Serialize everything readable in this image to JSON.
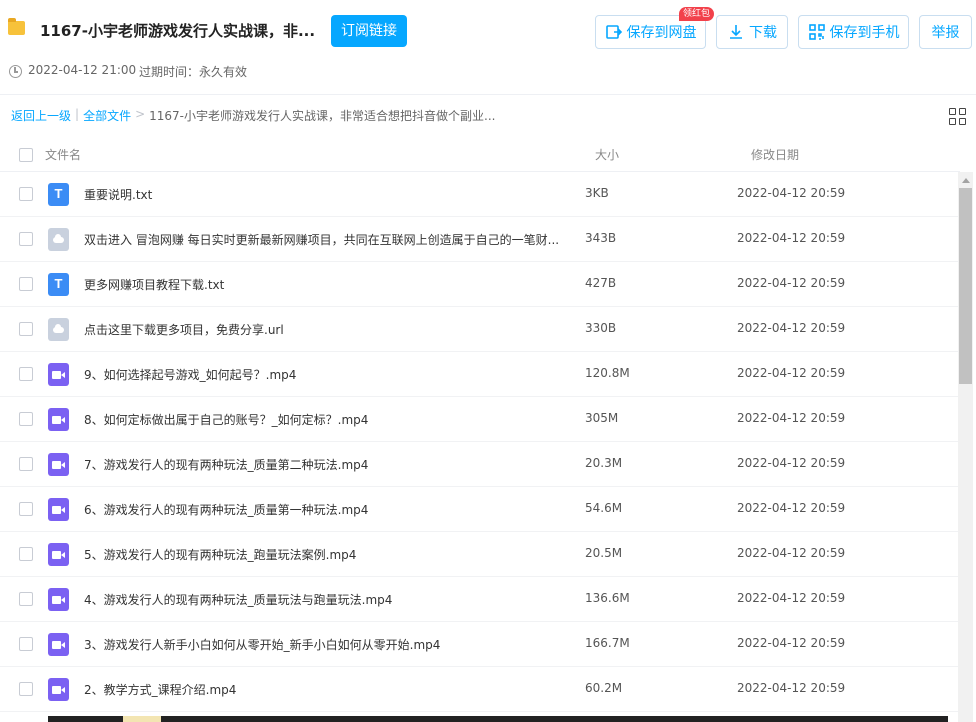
{
  "header": {
    "title": "1167-小宇老师游戏发行人实战课，非...",
    "subscribe_label": "订阅链接",
    "save_to_disk_label": "保存到网盘",
    "hongbao_badge": "领红包",
    "download_label": "下载",
    "save_to_phone_label": "保存到手机",
    "report_label": "举报",
    "date": "2022-04-12 21:00",
    "expire": "过期时间：永久有效"
  },
  "breadcrumb": {
    "back": "返回上一级",
    "sep1": "|",
    "all_files": "全部文件",
    "sep2": ">",
    "current": "1167-小宇老师游戏发行人实战课，非常适合想把抖音做个副业..."
  },
  "columns": {
    "name": "文件名",
    "size": "大小",
    "date": "修改日期"
  },
  "files": [
    {
      "name": "重要说明.txt",
      "size": "3KB",
      "date": "2022-04-12 20:59",
      "icon": "txt-file-icon"
    },
    {
      "name": "双击进入 冒泡网赚 每日实时更新最新网赚项目，共同在互联网上创造属于自己的一笔财...",
      "size": "343B",
      "date": "2022-04-12 20:59",
      "icon": "url-file-icon"
    },
    {
      "name": "更多网赚项目教程下载.txt",
      "size": "427B",
      "date": "2022-04-12 20:59",
      "icon": "txt-file-icon"
    },
    {
      "name": "点击这里下载更多项目，免费分享.url",
      "size": "330B",
      "date": "2022-04-12 20:59",
      "icon": "url-file-icon"
    },
    {
      "name": "9、如何选择起号游戏_如何起号？.mp4",
      "size": "120.8M",
      "date": "2022-04-12 20:59",
      "icon": "video-file-icon"
    },
    {
      "name": "8、如何定标做出属于自己的账号？_如何定标？.mp4",
      "size": "305M",
      "date": "2022-04-12 20:59",
      "icon": "video-file-icon"
    },
    {
      "name": "7、游戏发行人的现有两种玩法_质量第二种玩法.mp4",
      "size": "20.3M",
      "date": "2022-04-12 20:59",
      "icon": "video-file-icon"
    },
    {
      "name": "6、游戏发行人的现有两种玩法_质量第一种玩法.mp4",
      "size": "54.6M",
      "date": "2022-04-12 20:59",
      "icon": "video-file-icon"
    },
    {
      "name": "5、游戏发行人的现有两种玩法_跑量玩法案例.mp4",
      "size": "20.5M",
      "date": "2022-04-12 20:59",
      "icon": "video-file-icon"
    },
    {
      "name": "4、游戏发行人的现有两种玩法_质量玩法与跑量玩法.mp4",
      "size": "136.6M",
      "date": "2022-04-12 20:59",
      "icon": "video-file-icon"
    },
    {
      "name": "3、游戏发行人新手小白如何从零开始_新手小白如何从零开始.mp4",
      "size": "166.7M",
      "date": "2022-04-12 20:59",
      "icon": "video-file-icon"
    },
    {
      "name": "2、教学方式_课程介绍.mp4",
      "size": "60.2M",
      "date": "2022-04-12 20:59",
      "icon": "video-file-icon"
    }
  ],
  "colors": {
    "accent": "#06a7ff",
    "txt_icon": "#3b8cf5",
    "video_icon": "#7b61f2",
    "url_icon": "#c9d1de",
    "badge": "#f2414b"
  }
}
